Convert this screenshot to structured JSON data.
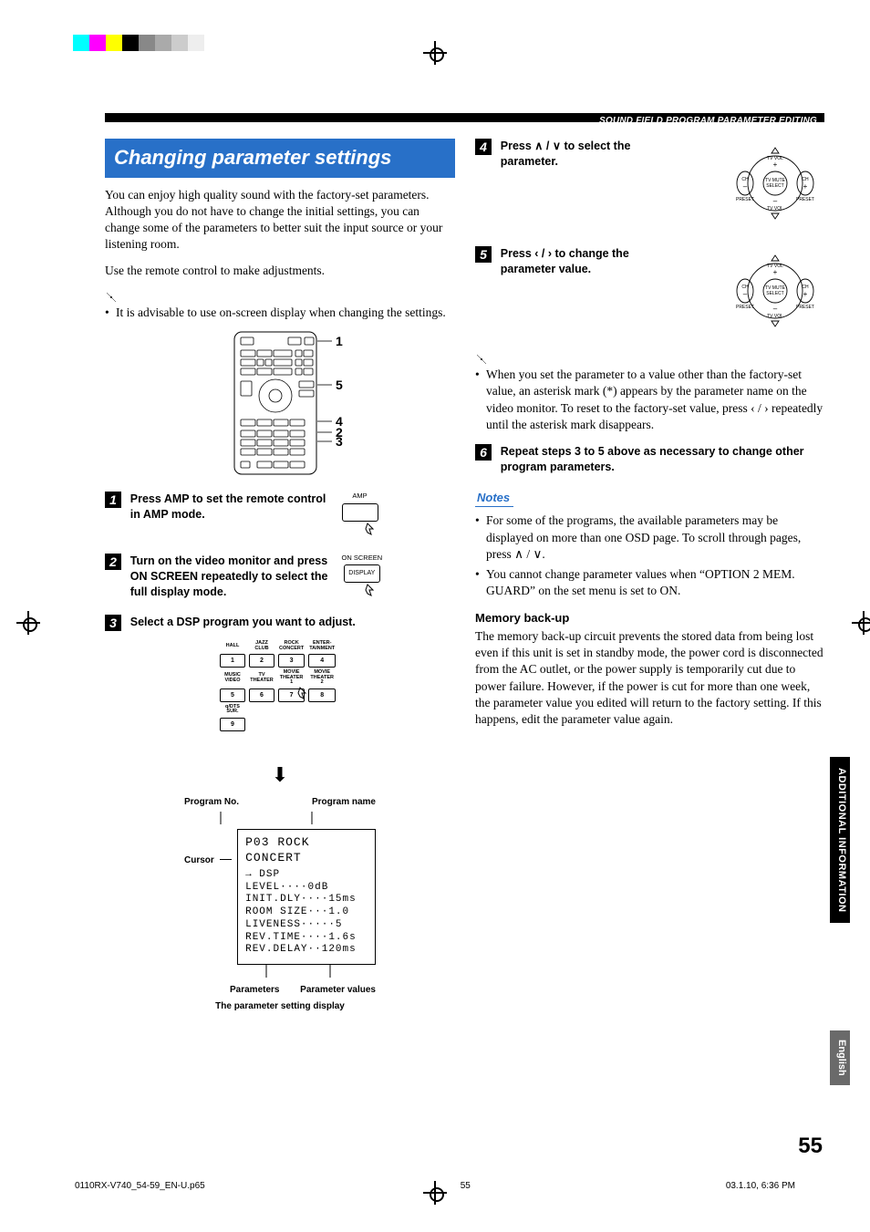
{
  "header": {
    "section_title": "SOUND FIELD PROGRAM PARAMETER EDITING"
  },
  "left": {
    "h1": "Changing parameter settings",
    "intro": "You can enjoy high quality sound with the factory-set parameters. Although you do not have to change the initial settings, you can change some of the parameters to better suit the input source or your listening room.",
    "use_remote": "Use the remote control to make adjustments.",
    "tip1": "It is advisable to use on-screen display when changing the settings.",
    "step1": "Press AMP to set the remote control in AMP mode.",
    "amp_label": "AMP",
    "step2": "Turn on the video monitor and press ON SCREEN repeatedly to select the full display mode.",
    "onscreen_label": "ON SCREEN",
    "display_label": "DISPLAY",
    "step3": "Select a DSP program you want to adjust.",
    "dsp_labels": [
      [
        "HALL",
        "JAZZ CLUB",
        "ROCK CONCERT",
        "ENTER-TAINMENT"
      ],
      [
        "MUSIC VIDEO",
        "TV THEATER",
        "MOVIE THEATER 1",
        "MOVIE THEATER 2"
      ],
      [
        "q/DTS SUR.",
        "",
        "",
        ""
      ]
    ],
    "dsp_nums": [
      [
        "1",
        "2",
        "3",
        "4"
      ],
      [
        "5",
        "6",
        "7",
        "8"
      ],
      [
        "9",
        "",
        "",
        ""
      ]
    ],
    "osd_top": {
      "progno": "Program No.",
      "progname": "Program name"
    },
    "osd_cursor": "Cursor",
    "osd_title": "P03 ROCK CONCERT",
    "osd_lines": [
      "→ DSP LEVEL····0dB",
      "  INIT.DLY····15ms",
      "  ROOM SIZE···1.0",
      "  LIVENESS·····5",
      "  REV.TIME····1.6s",
      "  REV.DELAY··120ms"
    ],
    "osd_bottom": {
      "params": "Parameters",
      "vals": "Parameter values"
    },
    "osd_caption": "The parameter setting display",
    "callouts": [
      "1",
      "5",
      "4",
      "2",
      "3"
    ]
  },
  "right": {
    "step4": "Press ∧ / ∨ to select the parameter.",
    "step5": "Press ‹ / › to change the parameter value.",
    "tip2": "When you set the parameter to a value other than the factory-set value, an asterisk mark (*) appears by the parameter name on the video monitor. To reset to the factory-set value, press ‹ / › repeatedly until the asterisk mark disappears.",
    "step6": "Repeat steps 3 to 5 above as necessary to change other program parameters.",
    "notes_h": "Notes",
    "note1": "For some of the programs, the available parameters may be displayed on more than one OSD page. To scroll through pages, press ∧ / ∨.",
    "note2": "You cannot change parameter values when “OPTION 2 MEM. GUARD” on the set menu is set to ON.",
    "mem_h": "Memory back-up",
    "mem_body": "The memory back-up circuit prevents the stored data from being lost even if this unit is set in standby mode, the power cord is disconnected from the AC outlet, or the power supply is temporarily cut due to power failure. However, if the power is cut for more than one week, the parameter value you edited will return to the factory setting. If this happens, edit the parameter value again.",
    "nav_labels": {
      "tvvol_up": "TV VOL",
      "tvvol_dn": "TV VOL",
      "ch_l": "CH",
      "ch_r": "CH",
      "center": "TV MUTE\nSELECT",
      "preset_l": "PRESET",
      "preset_r": "PRESET",
      "plus": "+",
      "minus": "–"
    }
  },
  "tabs": {
    "main": "ADDITIONAL INFORMATION",
    "lang": "English"
  },
  "page_num": "55",
  "footer": {
    "l": "0110RX-V740_54-59_EN-U.p65",
    "c": "55",
    "r": "03.1.10, 6:36 PM"
  }
}
